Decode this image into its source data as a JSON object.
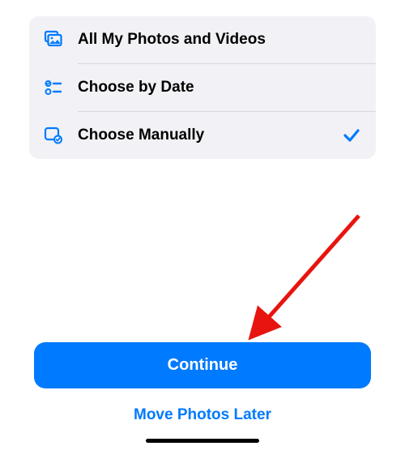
{
  "options": {
    "items": [
      {
        "label": "All My Photos and Videos",
        "selected": false
      },
      {
        "label": "Choose by Date",
        "selected": false
      },
      {
        "label": "Choose Manually",
        "selected": true
      }
    ]
  },
  "buttons": {
    "continue_label": "Continue",
    "later_label": "Move Photos Later"
  },
  "colors": {
    "accent": "#007aff",
    "card_bg": "#f2f2f6"
  }
}
